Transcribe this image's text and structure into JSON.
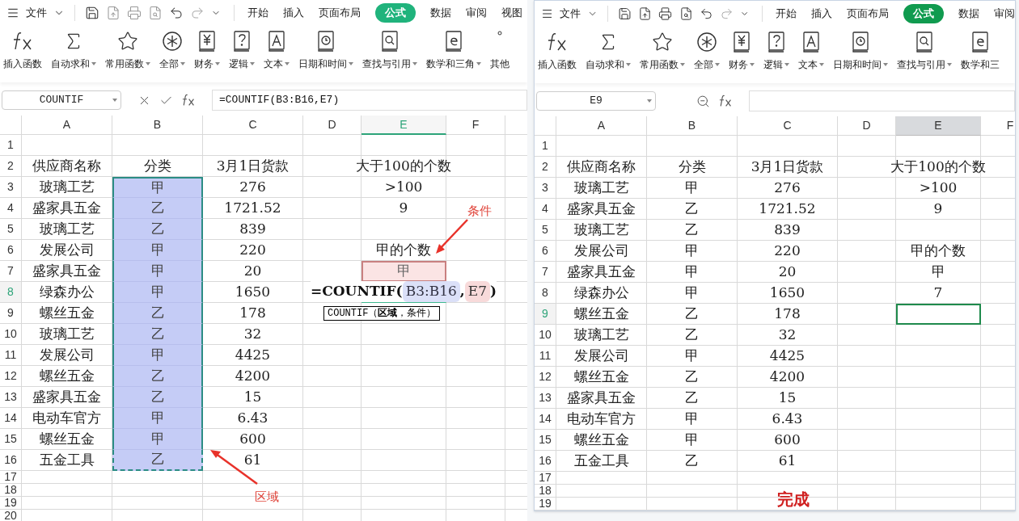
{
  "windows": [
    {
      "menu": {
        "label": "文件"
      },
      "tabs": [
        {
          "label": "开始",
          "selected": false
        },
        {
          "label": "插入",
          "selected": false
        },
        {
          "label": "页面布局",
          "selected": false
        },
        {
          "label": "公式",
          "selected": true
        },
        {
          "label": "数据",
          "selected": false
        },
        {
          "label": "审阅",
          "selected": false
        },
        {
          "label": "视图",
          "selected": false
        }
      ],
      "ribbon": [
        {
          "label": "插入函数",
          "dropdown": false
        },
        {
          "label": "自动求和",
          "dropdown": true
        },
        {
          "label": "常用函数",
          "dropdown": true
        },
        {
          "label": "全部",
          "dropdown": true
        },
        {
          "label": "财务",
          "dropdown": true
        },
        {
          "label": "逻辑",
          "dropdown": true
        },
        {
          "label": "文本",
          "dropdown": true
        },
        {
          "label": "日期和时间",
          "dropdown": true
        },
        {
          "label": "查找与引用",
          "dropdown": true
        },
        {
          "label": "数学和三角",
          "dropdown": true
        },
        {
          "label": "其他",
          "dropdown": false
        }
      ],
      "name_box": "COUNTIF",
      "editing": true,
      "formula": "=COUNTIF(B3:B16,E7)",
      "columns": [
        {
          "label": "A",
          "selected": false
        },
        {
          "label": "B",
          "selected": false
        },
        {
          "label": "C",
          "selected": false
        },
        {
          "label": "D",
          "selected": false
        },
        {
          "label": "E",
          "selected": true
        },
        {
          "label": "F",
          "selected": false
        }
      ],
      "rows": [
        {
          "label": "1",
          "selected": false,
          "cells": []
        },
        {
          "label": "2",
          "selected": false,
          "cells": [
            "供应商名称",
            "分类",
            "3月1日货款",
            null,
            "大于100的个数"
          ]
        },
        {
          "label": "3",
          "selected": false,
          "cells": [
            "玻璃工艺",
            {
              "kind": "range",
              "text": "甲"
            },
            "276",
            null,
            ">100"
          ]
        },
        {
          "label": "4",
          "selected": false,
          "cells": [
            "盛家具五金",
            {
              "kind": "range",
              "text": "乙"
            },
            "1721.52",
            null,
            "9"
          ]
        },
        {
          "label": "5",
          "selected": false,
          "cells": [
            "玻璃工艺",
            {
              "kind": "range",
              "text": "乙"
            },
            "839"
          ]
        },
        {
          "label": "6",
          "selected": false,
          "cells": [
            "发展公司",
            {
              "kind": "range",
              "text": "甲"
            },
            "220",
            null,
            "甲的个数"
          ]
        },
        {
          "label": "7",
          "selected": false,
          "cells": [
            "盛家具五金",
            {
              "kind": "range",
              "text": "甲"
            },
            "20",
            null,
            {
              "kind": "criteria",
              "text": "甲"
            }
          ]
        },
        {
          "label": "8",
          "selected": true,
          "cells": [
            "绿森办公",
            {
              "kind": "range",
              "text": "甲"
            },
            "1650",
            null,
            {
              "kind": "editing",
              "parts": [
                {
                  "kind": "plain",
                  "text": "=COUNTIF("
                },
                {
                  "kind": "range",
                  "text": "B3:B16"
                },
                {
                  "kind": "plain",
                  "text": ","
                },
                {
                  "kind": "criteria",
                  "text": "E7"
                },
                {
                  "kind": "plain",
                  "text": ")"
                }
              ],
              "tooltip": "COUNTIF（**区域**，条件）"
            }
          ]
        },
        {
          "label": "9",
          "selected": false,
          "cells": [
            "螺丝五金",
            {
              "kind": "range",
              "text": "乙"
            },
            "178"
          ]
        },
        {
          "label": "10",
          "selected": false,
          "cells": [
            "玻璃工艺",
            {
              "kind": "range",
              "text": "乙"
            },
            "32"
          ]
        },
        {
          "label": "11",
          "selected": false,
          "cells": [
            "发展公司",
            {
              "kind": "range",
              "text": "甲"
            },
            "4425"
          ]
        },
        {
          "label": "12",
          "selected": false,
          "cells": [
            "螺丝五金",
            {
              "kind": "range",
              "text": "乙"
            },
            "4200"
          ]
        },
        {
          "label": "13",
          "selected": false,
          "cells": [
            "盛家具五金",
            {
              "kind": "range",
              "text": "乙"
            },
            "15"
          ]
        },
        {
          "label": "14",
          "selected": false,
          "cells": [
            "电动车官方",
            {
              "kind": "range",
              "text": "甲"
            },
            "6.43"
          ]
        },
        {
          "label": "15",
          "selected": false,
          "cells": [
            "螺丝五金",
            {
              "kind": "range",
              "text": "甲"
            },
            "600"
          ]
        },
        {
          "label": "16",
          "selected": false,
          "cells": [
            "五金工具",
            {
              "kind": "range",
              "text": "乙"
            },
            "61"
          ]
        },
        {
          "label": "17",
          "selected": false,
          "cells": []
        },
        {
          "label": "18",
          "selected": false,
          "cells": []
        },
        {
          "label": "19",
          "selected": false,
          "cells": []
        },
        {
          "label": "20",
          "selected": false,
          "cells": []
        }
      ],
      "annotations": [
        {
          "text": "条件"
        },
        {
          "text": "区域"
        }
      ]
    },
    {
      "menu": {
        "label": "文件"
      },
      "tabs": [
        {
          "label": "开始",
          "selected": false
        },
        {
          "label": "插入",
          "selected": false
        },
        {
          "label": "页面布局",
          "selected": false
        },
        {
          "label": "公式",
          "selected": true
        },
        {
          "label": "数据",
          "selected": false
        },
        {
          "label": "审阅",
          "selected": false
        }
      ],
      "ribbon": [
        {
          "label": "插入函数",
          "dropdown": false
        },
        {
          "label": "自动求和",
          "dropdown": true
        },
        {
          "label": "常用函数",
          "dropdown": true
        },
        {
          "label": "全部",
          "dropdown": true
        },
        {
          "label": "财务",
          "dropdown": true
        },
        {
          "label": "逻辑",
          "dropdown": true
        },
        {
          "label": "文本",
          "dropdown": true
        },
        {
          "label": "日期和时间",
          "dropdown": true
        },
        {
          "label": "查找与引用",
          "dropdown": true
        },
        {
          "label": "数学和三",
          "dropdown": false
        }
      ],
      "name_box": "E9",
      "editing": false,
      "columns": [
        {
          "label": "A",
          "selected": false
        },
        {
          "label": "B",
          "selected": false
        },
        {
          "label": "C",
          "selected": false
        },
        {
          "label": "D",
          "selected": false
        },
        {
          "label": "E",
          "selected": true
        },
        {
          "label": "F",
          "selected": false
        }
      ],
      "rows": [
        {
          "label": "1",
          "selected": false,
          "cells": []
        },
        {
          "label": "2",
          "selected": false,
          "cells": [
            "供应商名称",
            "分类",
            "3月1日货款",
            null,
            "大于100的个数"
          ]
        },
        {
          "label": "3",
          "selected": false,
          "cells": [
            "玻璃工艺",
            "甲",
            "276",
            null,
            ">100"
          ]
        },
        {
          "label": "4",
          "selected": false,
          "cells": [
            "盛家具五金",
            "乙",
            "1721.52",
            null,
            "9"
          ]
        },
        {
          "label": "5",
          "selected": false,
          "cells": [
            "玻璃工艺",
            "乙",
            "839"
          ]
        },
        {
          "label": "6",
          "selected": false,
          "cells": [
            "发展公司",
            "甲",
            "220",
            null,
            "甲的个数"
          ]
        },
        {
          "label": "7",
          "selected": false,
          "cells": [
            "盛家具五金",
            "甲",
            "20",
            null,
            "甲"
          ]
        },
        {
          "label": "8",
          "selected": false,
          "cells": [
            "绿森办公",
            "甲",
            "1650",
            null,
            "7"
          ]
        },
        {
          "label": "9",
          "selected": true,
          "cells": [
            "螺丝五金",
            "乙",
            "178",
            null,
            {
              "kind": "active"
            }
          ]
        },
        {
          "label": "10",
          "selected": false,
          "cells": [
            "玻璃工艺",
            "乙",
            "32"
          ]
        },
        {
          "label": "11",
          "selected": false,
          "cells": [
            "发展公司",
            "甲",
            "4425"
          ]
        },
        {
          "label": "12",
          "selected": false,
          "cells": [
            "螺丝五金",
            "乙",
            "4200"
          ]
        },
        {
          "label": "13",
          "selected": false,
          "cells": [
            "盛家具五金",
            "乙",
            "15"
          ]
        },
        {
          "label": "14",
          "selected": false,
          "cells": [
            "电动车官方",
            "甲",
            "6.43"
          ]
        },
        {
          "label": "15",
          "selected": false,
          "cells": [
            "螺丝五金",
            "甲",
            "600"
          ]
        },
        {
          "label": "16",
          "selected": false,
          "cells": [
            "五金工具",
            "乙",
            "61"
          ]
        },
        {
          "label": "17",
          "selected": false,
          "cells": []
        },
        {
          "label": "18",
          "selected": false,
          "cells": []
        },
        {
          "label": "19",
          "selected": false,
          "cells": []
        }
      ],
      "annotations": [
        {
          "text": "完成"
        }
      ]
    }
  ]
}
